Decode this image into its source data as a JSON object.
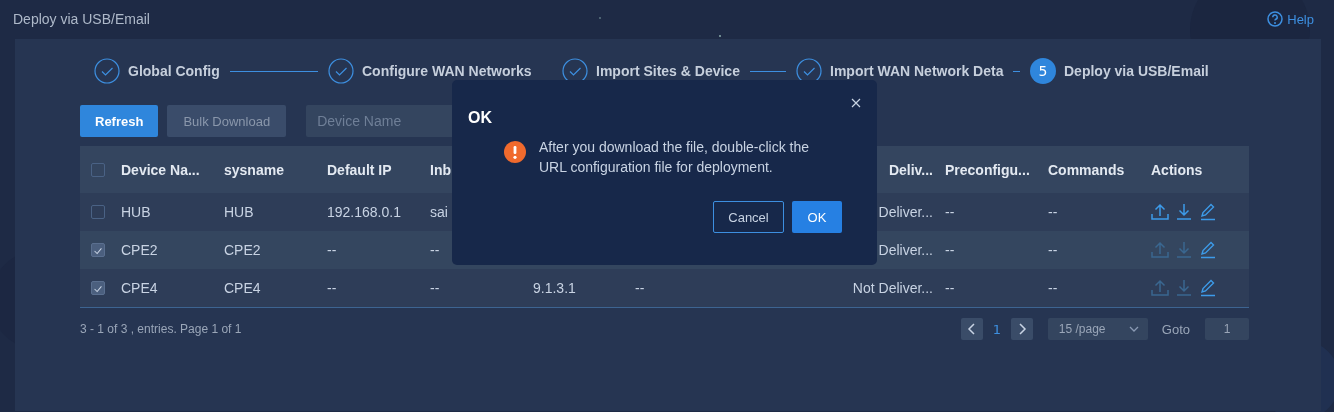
{
  "page_title": "Deploy via USB/Email",
  "help": "Help",
  "steps": [
    {
      "label": "Global Config",
      "done": true
    },
    {
      "label": "Configure WAN Networks",
      "done": true
    },
    {
      "label": "Import Sites & Device",
      "done": true
    },
    {
      "label": "Import WAN Network Deta",
      "done": true
    },
    {
      "label": "Deploy via USB/Email",
      "done": false,
      "number": "5"
    }
  ],
  "toolbar": {
    "buttons": [
      {
        "label": "Refresh",
        "disabled": false
      },
      {
        "label": "Bulk Download",
        "disabled": true
      }
    ],
    "search": {
      "placeholder": "Device Name"
    }
  },
  "table": {
    "all_checked": false,
    "header": {
      "device_name": "Device Na...",
      "sysname": "sysname",
      "default_ip": "Default IP",
      "column_4": "Inb",
      "column_7": "Deliv...",
      "preconfigured": "Preconfigu...",
      "commands": "Commands",
      "actions": "Actions"
    },
    "rows": [
      {
        "checked": false,
        "transfer_enabled": true,
        "device_name": "HUB",
        "sysname": "HUB",
        "default_ip": "192.168.0.1",
        "column_4": "sai",
        "column_7": "Deliver...",
        "preconfigured": "--",
        "commands": "--"
      },
      {
        "checked": true,
        "transfer_enabled": false,
        "device_name": "CPE2",
        "sysname": "CPE2",
        "default_ip": "--",
        "column_4": "--",
        "column_7": "Deliver...",
        "preconfigured": "--",
        "commands": "--"
      },
      {
        "checked": true,
        "transfer_enabled": false,
        "device_name": "CPE4",
        "sysname": "CPE4",
        "default_ip": "--",
        "column_4": "--",
        "column_5": "9.1.3.1",
        "column_6": "--",
        "column_7": "Not Deliver...",
        "preconfigured": "--",
        "commands": "--"
      }
    ]
  },
  "footer": {
    "summary": "3 - 1 of 3 , entries. Page 1 of 1",
    "pages": [
      {
        "label": "1",
        "selected": true
      }
    ],
    "page_size": "15 /page",
    "goto_label": "Goto",
    "goto_value": "1"
  },
  "dialog": {
    "title": "OK",
    "message": "After you download the file, double-click the URL configuration file for deployment.",
    "buttons": [
      {
        "label": "Cancel",
        "kind": "secondary"
      },
      {
        "label": "OK",
        "kind": "primary"
      }
    ]
  }
}
